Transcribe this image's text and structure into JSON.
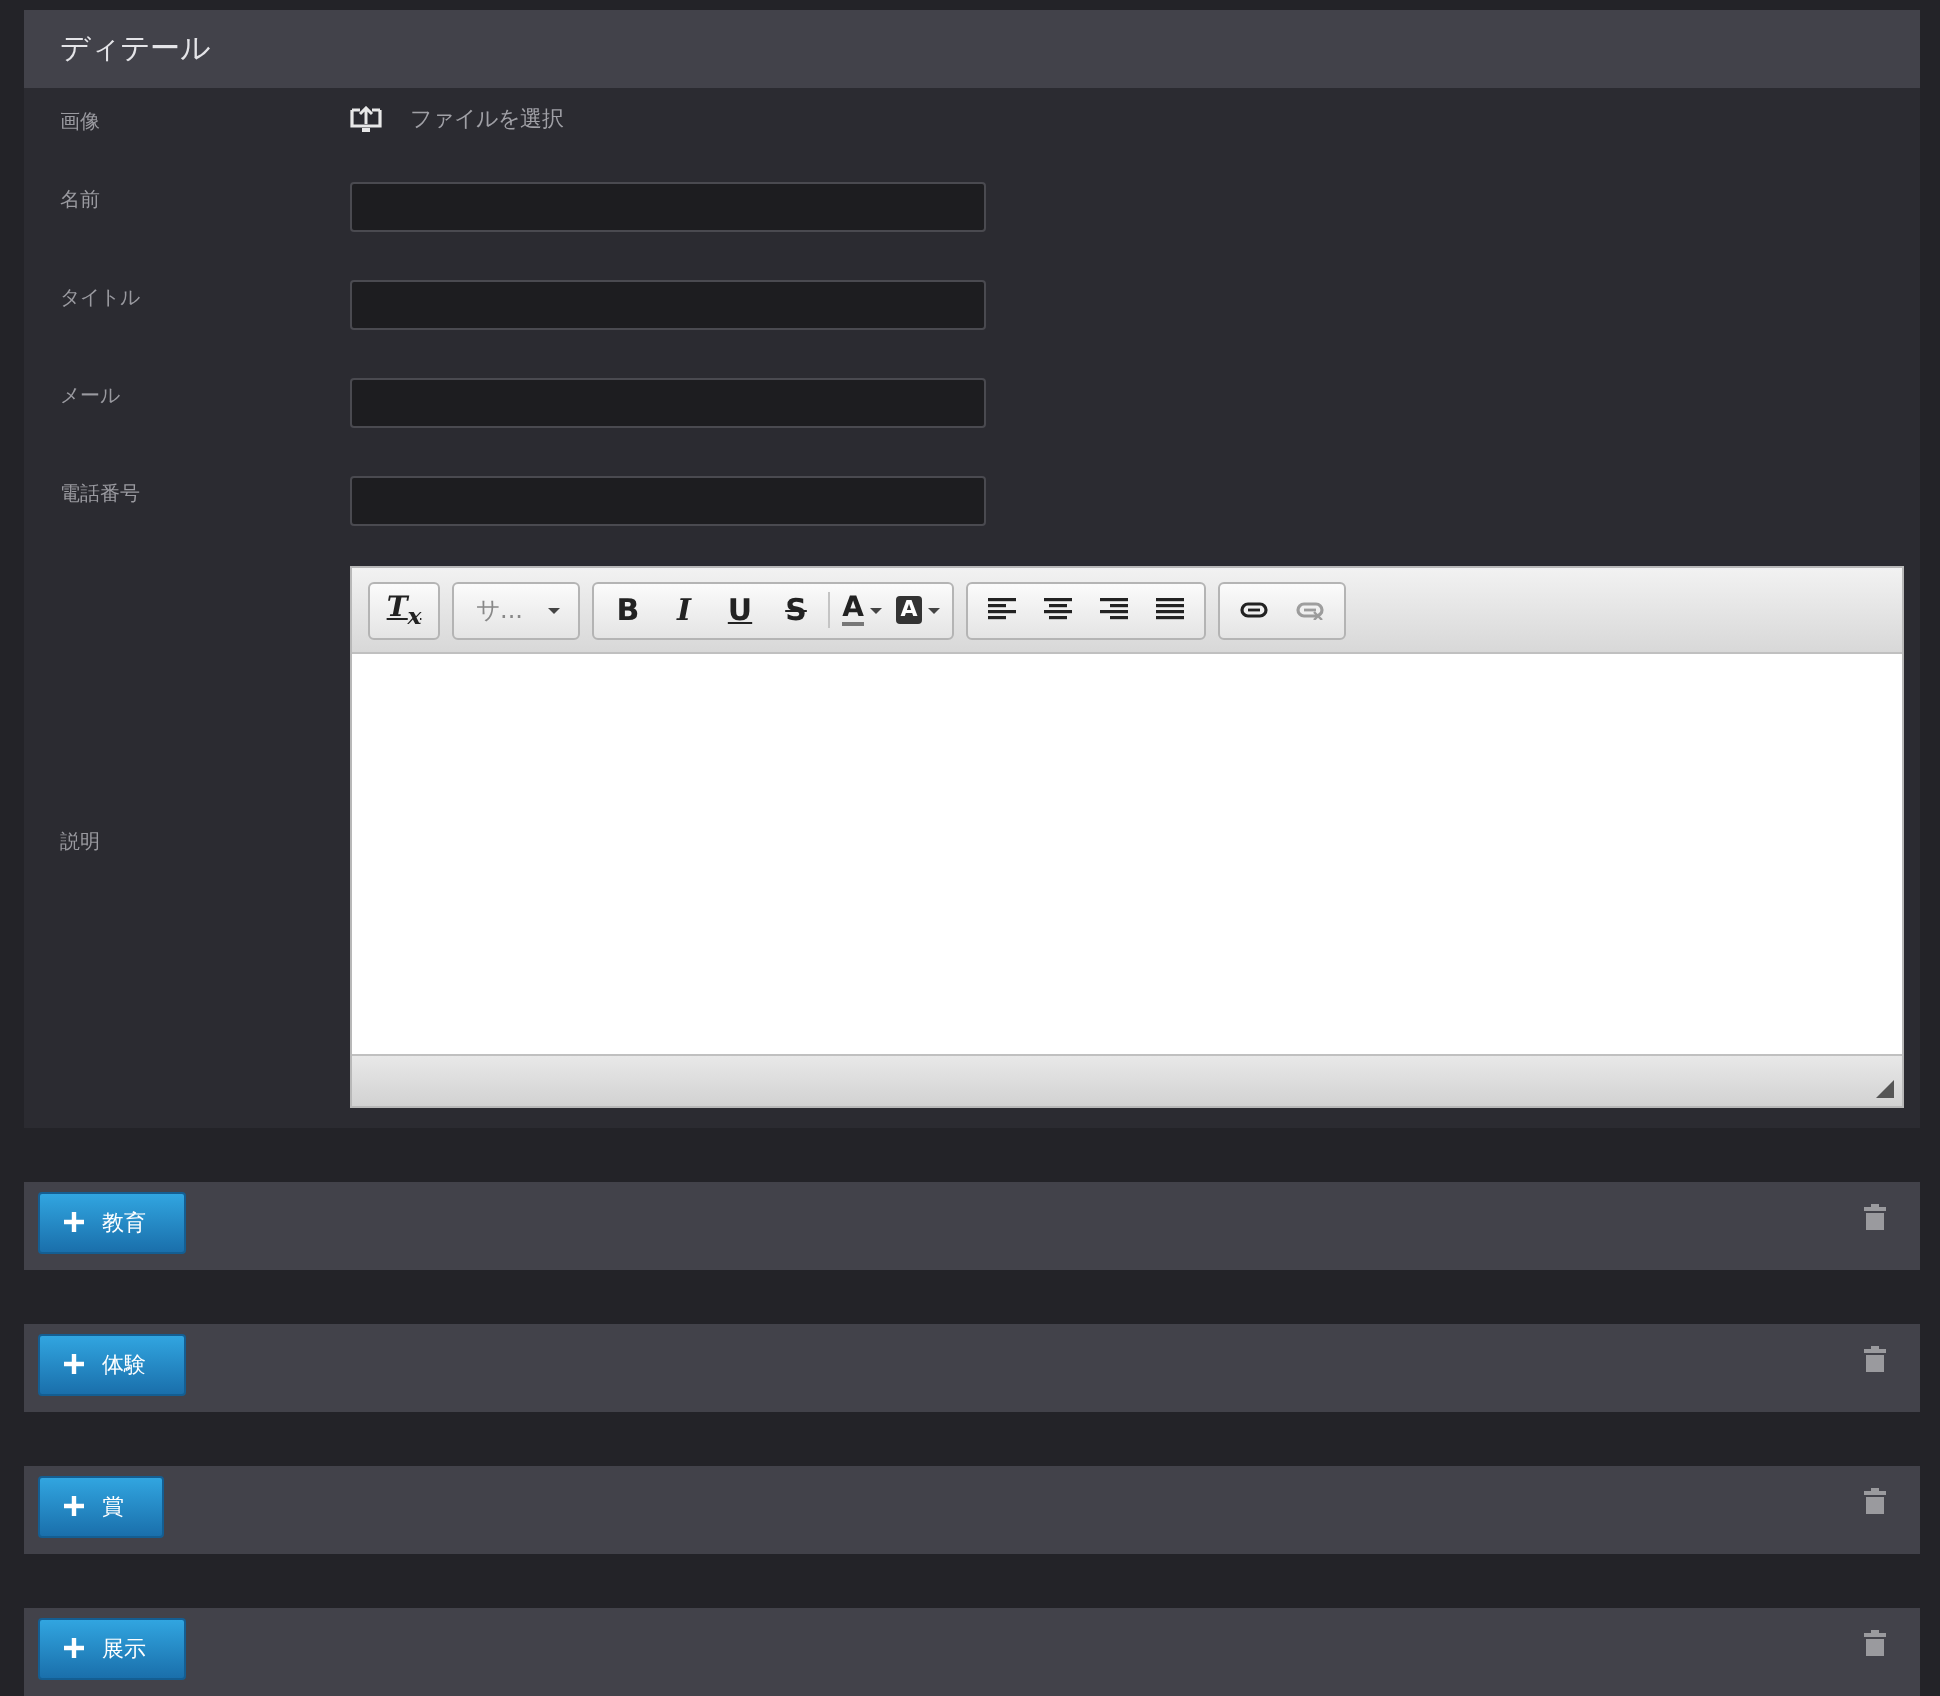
{
  "panel": {
    "title": "ディテール",
    "image_row": {
      "label": "画像",
      "button": "ファイルを選択"
    },
    "fields": [
      {
        "label": "名前"
      },
      {
        "label": "タイトル"
      },
      {
        "label": "メール"
      },
      {
        "label": "電話番号"
      }
    ],
    "description": {
      "label": "説明",
      "toolbar": [
        {
          "items": [
            {
              "kind": "clear",
              "glyph": "T$_{x}$",
              "disabled": false
            }
          ]
        },
        {
          "items": [
            {
              "kind": "dropdown",
              "glyph": "サ...",
              "disabled": false
            }
          ]
        },
        {
          "items": [
            {
              "kind": "bold",
              "glyph": "B",
              "disabled": false
            },
            {
              "kind": "italic",
              "glyph": "I",
              "disabled": false
            },
            {
              "kind": "underline",
              "glyph": "U",
              "disabled": false
            },
            {
              "kind": "strike",
              "glyph": "S",
              "disabled": false
            },
            {
              "kind": "textcolor",
              "glyph": "A",
              "disabled": false
            },
            {
              "kind": "bgcolor",
              "glyph": "A",
              "disabled": false
            }
          ]
        },
        {
          "items": [
            {
              "kind": "align-left",
              "disabled": false
            },
            {
              "kind": "align-center",
              "disabled": false
            },
            {
              "kind": "align-right",
              "disabled": false
            },
            {
              "kind": "justify",
              "disabled": false
            }
          ]
        },
        {
          "items": [
            {
              "kind": "link",
              "disabled": false
            },
            {
              "kind": "unlink",
              "disabled": true
            }
          ]
        }
      ]
    }
  },
  "sections": [
    {
      "button": "教育"
    },
    {
      "button": "体験"
    },
    {
      "button": "賞"
    },
    {
      "button": "展示"
    }
  ]
}
